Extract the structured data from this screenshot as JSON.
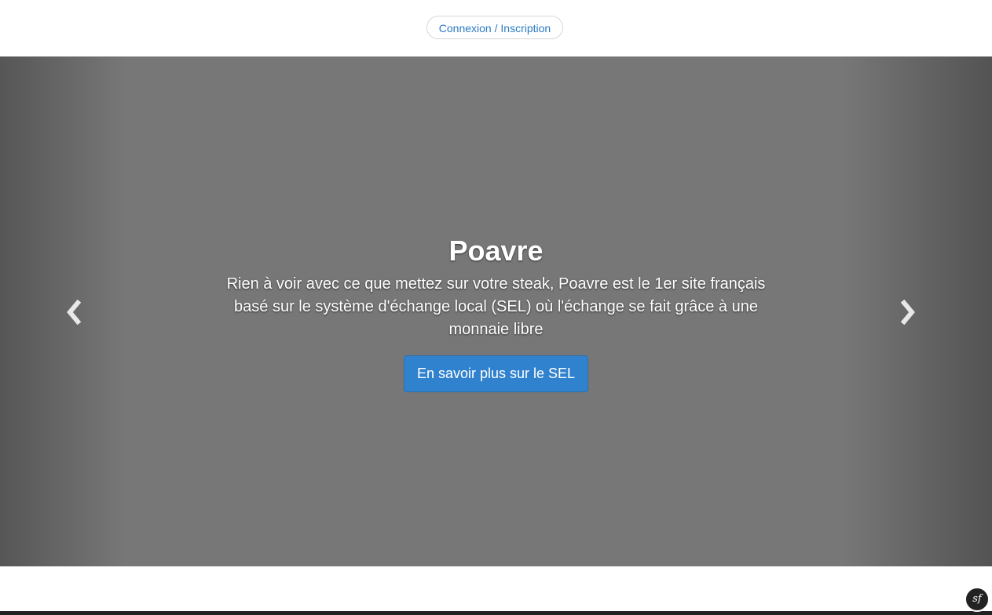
{
  "header": {
    "login_label": "Connexion / Inscription"
  },
  "carousel": {
    "title": "Poavre",
    "description": "Rien à voir avec ce que mettez sur votre steak, Poavre est le 1er site français basé sur le système d'échange local (SEL) où l'échange se fait grâce à une monnaie libre",
    "cta_label": "En savoir plus sur le SEL",
    "prev_icon": "chevron-left-icon",
    "next_icon": "chevron-right-icon",
    "background_color": "#777777",
    "button_color": "#3182ce"
  },
  "debug_toolbar": {
    "badge_label": "sf",
    "icon": "symfony-icon"
  }
}
